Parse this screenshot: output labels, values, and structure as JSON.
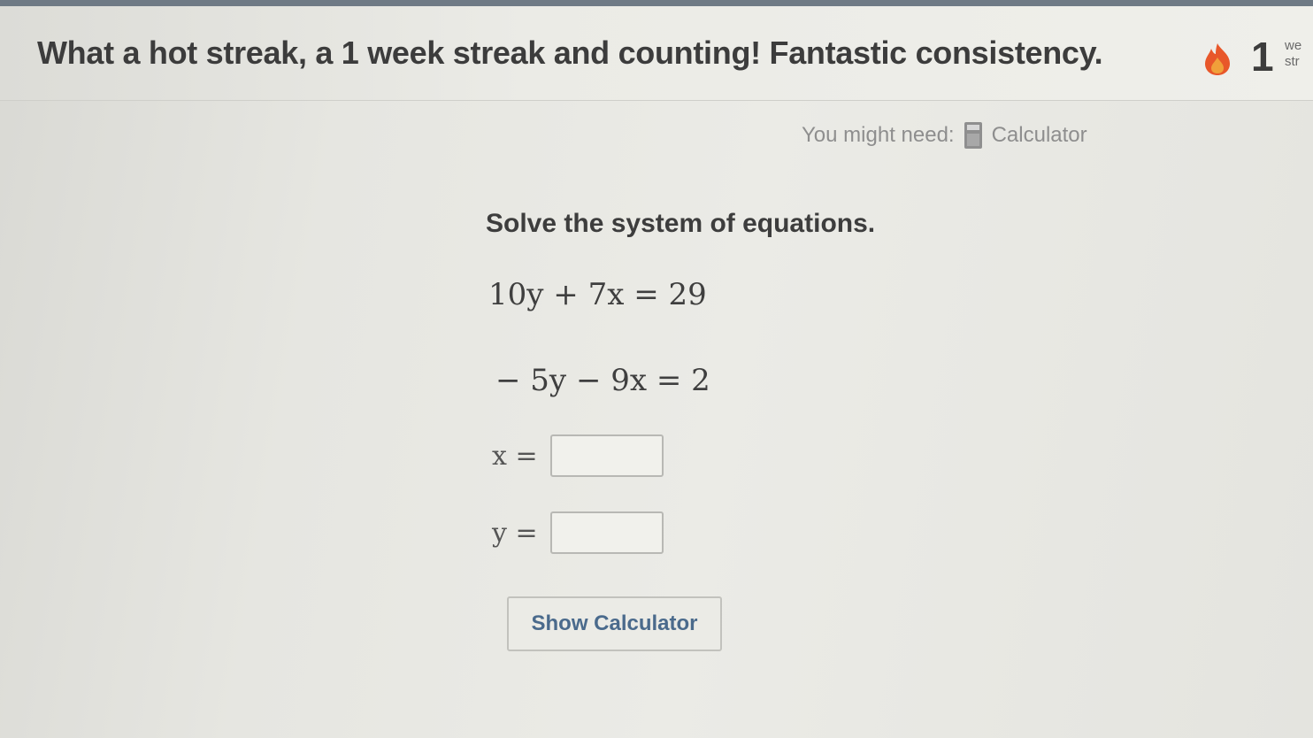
{
  "banner": {
    "message": "What a hot streak, a 1 week streak and counting! Fantastic consistency.",
    "streak_icon": "flame-icon",
    "streak_count": "1",
    "streak_unit_line1": "we",
    "streak_unit_line2": "str"
  },
  "tools": {
    "you_might_need": "You might need:",
    "calculator_icon": "calculator-icon",
    "calculator_label": "Calculator"
  },
  "problem": {
    "prompt": "Solve the system of equations.",
    "equations": [
      "10y + 7x = 29",
      "− 5y − 9x = 2"
    ],
    "answers": [
      {
        "label": "x =",
        "value": ""
      },
      {
        "label": "y =",
        "value": ""
      }
    ]
  },
  "actions": {
    "show_calculator": "Show Calculator"
  },
  "colors": {
    "flame": "#e8572a",
    "flame_inner": "#f0a03a",
    "button_text": "#4a6a8c"
  }
}
